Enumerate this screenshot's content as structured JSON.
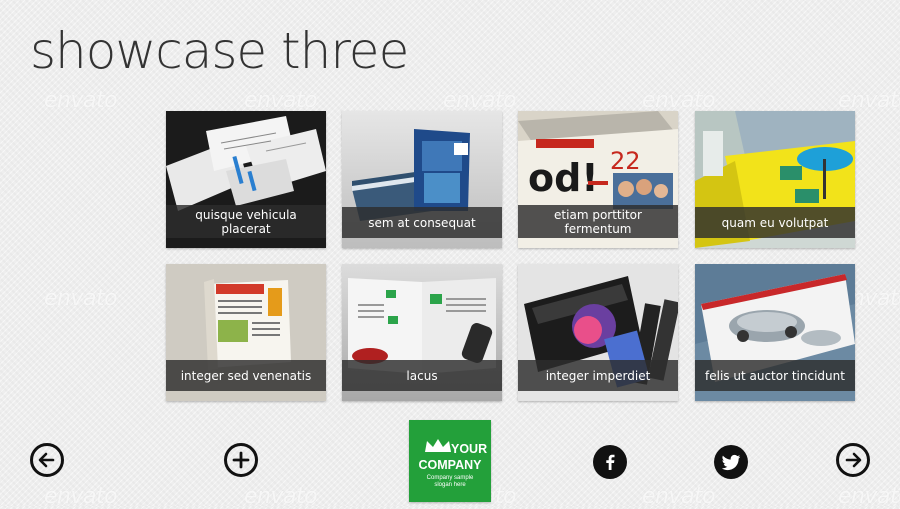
{
  "page": {
    "title": "showcase three",
    "watermark_text": "envato"
  },
  "tiles": [
    {
      "label": "quisque vehicula placerat",
      "art": "envelopes-stationery"
    },
    {
      "label": "sem at consequat",
      "art": "brochure-stack"
    },
    {
      "label": "etiam porttitor fermentum",
      "art": "magazine-spread-red"
    },
    {
      "label": "quam eu volutpat",
      "art": "3d-exhibition-booth"
    },
    {
      "label": "integer sed venenatis",
      "art": "newspaper-magazine"
    },
    {
      "label": "lacus",
      "art": "open-brochure-car"
    },
    {
      "label": "integer imperdiet",
      "art": "glossy-product-cards"
    },
    {
      "label": "felis ut auctor tincidunt",
      "art": "car-calendar"
    }
  ],
  "footer": {
    "prev_icon": "arrow-left-circle-icon",
    "add_icon": "plus-circle-icon",
    "facebook_icon": "facebook-icon",
    "twitter_icon": "twitter-icon",
    "next_icon": "arrow-right-circle-icon",
    "logo": {
      "line1": "YOUR",
      "line2": "COMPANY",
      "line3": "Company sample",
      "line4": "slogan here",
      "color": "#23a03a"
    }
  }
}
